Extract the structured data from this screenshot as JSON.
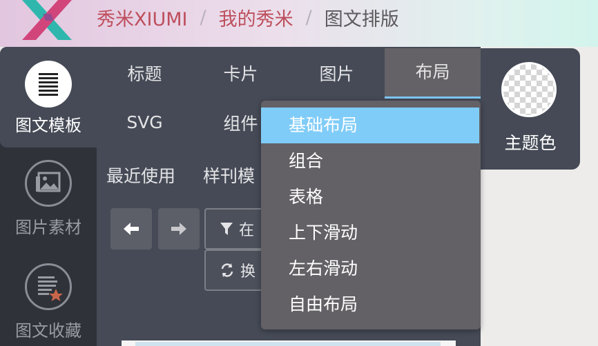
{
  "header": {
    "logo_icon": "xiumi-logo",
    "breadcrumbs": [
      {
        "label": "秀米XIUMI"
      },
      {
        "label": "我的秀米"
      },
      {
        "label": "图文排版"
      }
    ],
    "separator": "/"
  },
  "sidebar": {
    "items": [
      {
        "label": "图文模板",
        "icon": "list-icon",
        "active": true
      },
      {
        "label": "图片素材",
        "icon": "image-icon",
        "active": false
      },
      {
        "label": "图文收藏",
        "icon": "document-star-icon",
        "active": false
      }
    ]
  },
  "main": {
    "tabs_row1": [
      {
        "label": "标题"
      },
      {
        "label": "卡片"
      },
      {
        "label": "图片"
      },
      {
        "label": "布局",
        "active": true
      }
    ],
    "tabs_row2": [
      {
        "label": "SVG"
      },
      {
        "label": "组件"
      }
    ],
    "sub_tabs": [
      {
        "label": "最近使用"
      },
      {
        "label": "样刊模"
      }
    ],
    "nav": {
      "back_icon": "arrow-left-icon",
      "forward_icon": "arrow-right-icon"
    },
    "filter_button": {
      "label": "在",
      "icon": "filter-icon"
    },
    "refresh_button": {
      "label": "换",
      "icon": "refresh-icon"
    }
  },
  "dropdown": {
    "items": [
      {
        "label": "基础布局",
        "selected": true
      },
      {
        "label": "组合"
      },
      {
        "label": "表格"
      },
      {
        "label": "上下滑动"
      },
      {
        "label": "左右滑动"
      },
      {
        "label": "自由布局"
      }
    ]
  },
  "theme": {
    "label": "主题色",
    "swatch": "transparent-checker"
  },
  "colors": {
    "panel": "#454a56",
    "sidebar": "#2f3239",
    "accent": "#80ccf8",
    "breadcrumb_link": "#bd4e5c"
  }
}
